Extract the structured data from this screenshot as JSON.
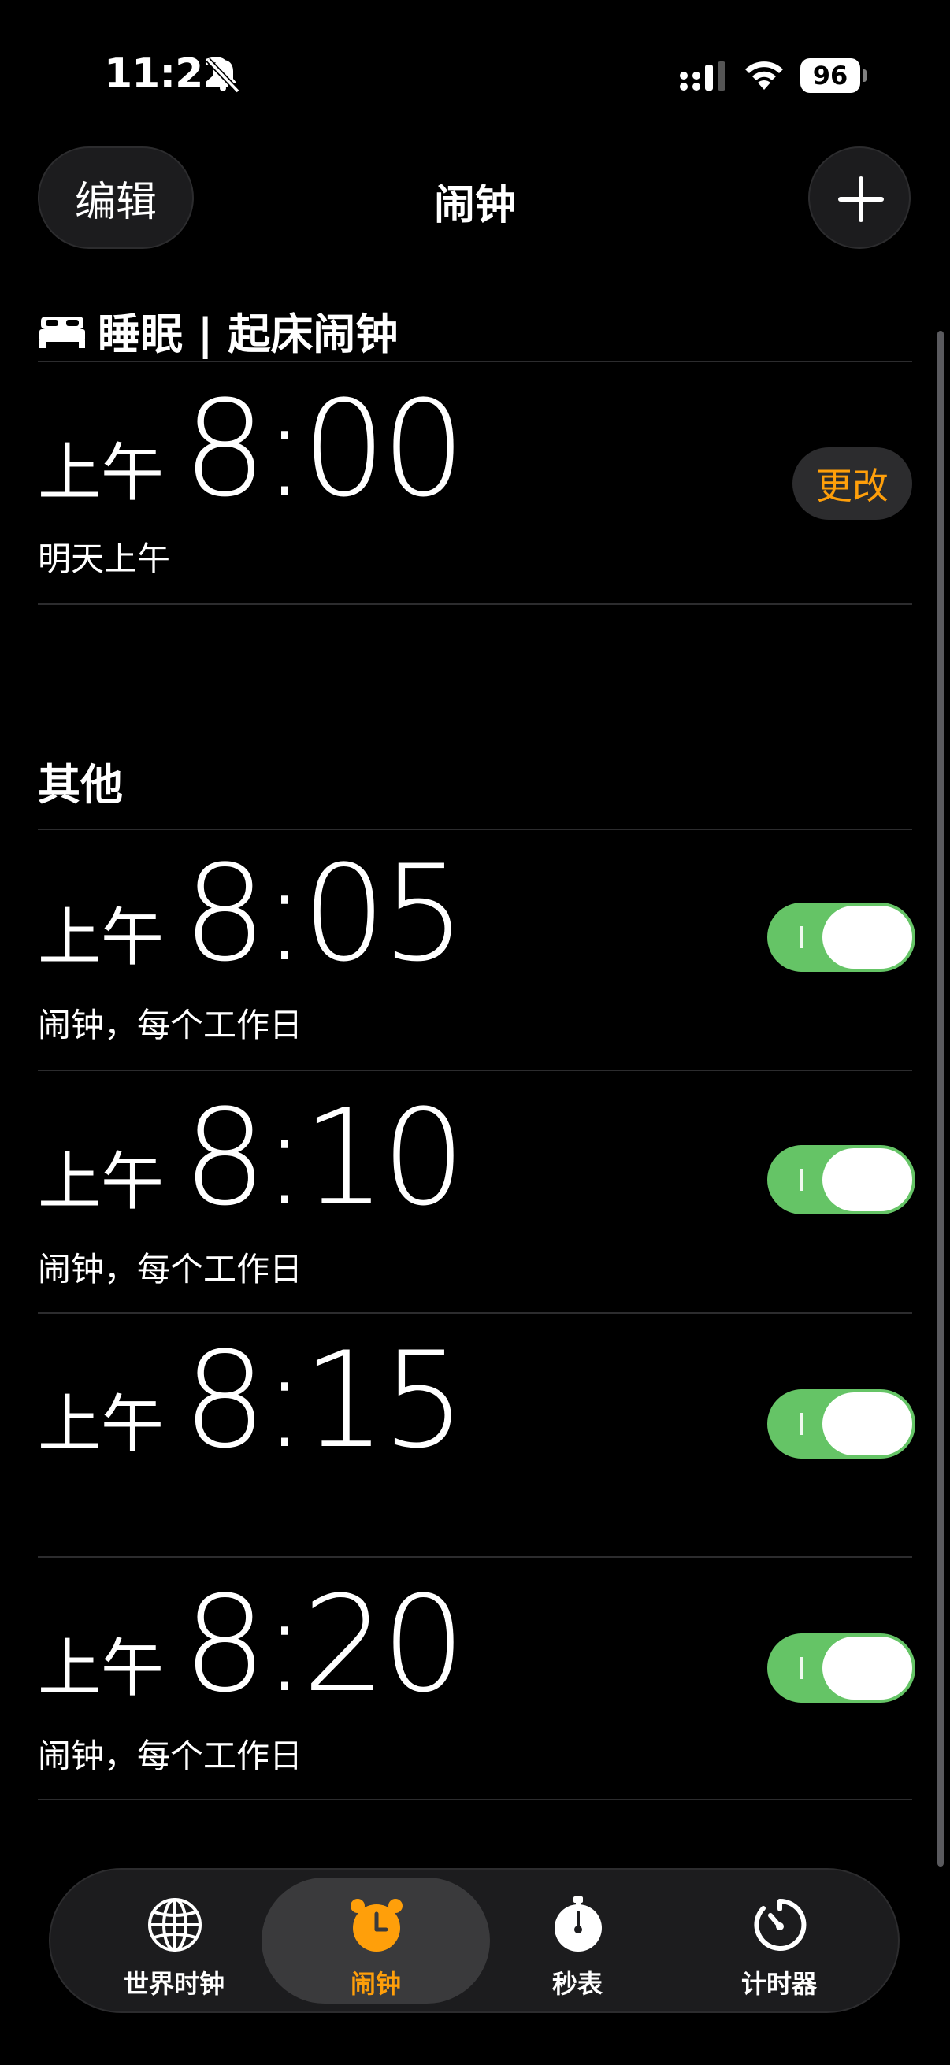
{
  "status_bar": {
    "time": "11:22",
    "battery": "96"
  },
  "header": {
    "edit_label": "编辑",
    "title": "闹钟"
  },
  "sleep_section": {
    "title": "睡眠 | 起床闹钟",
    "alarm": {
      "period": "上午",
      "time": "8:00",
      "subtitle": "明天上午",
      "change_label": "更改"
    }
  },
  "other_section": {
    "title": "其他",
    "alarms": [
      {
        "period": "上午",
        "time": "8:05",
        "subtitle": "闹钟，每个工作日",
        "enabled": true
      },
      {
        "period": "上午",
        "time": "8:10",
        "subtitle": "闹钟，每个工作日",
        "enabled": true
      },
      {
        "period": "上午",
        "time": "8:15",
        "subtitle": "",
        "enabled": true
      },
      {
        "period": "上午",
        "time": "8:20",
        "subtitle": "闹钟，每个工作日",
        "enabled": true
      }
    ]
  },
  "tabs": [
    {
      "label": "世界时钟",
      "icon": "globe-icon",
      "active": false
    },
    {
      "label": "闹钟",
      "icon": "alarm-clock-icon",
      "active": true
    },
    {
      "label": "秒表",
      "icon": "stopwatch-icon",
      "active": false
    },
    {
      "label": "计时器",
      "icon": "timer-icon",
      "active": false
    }
  ],
  "colors": {
    "accent": "#ff9f0a",
    "toggle_on": "#65c466",
    "background": "#000000",
    "card": "#1c1c1e"
  }
}
